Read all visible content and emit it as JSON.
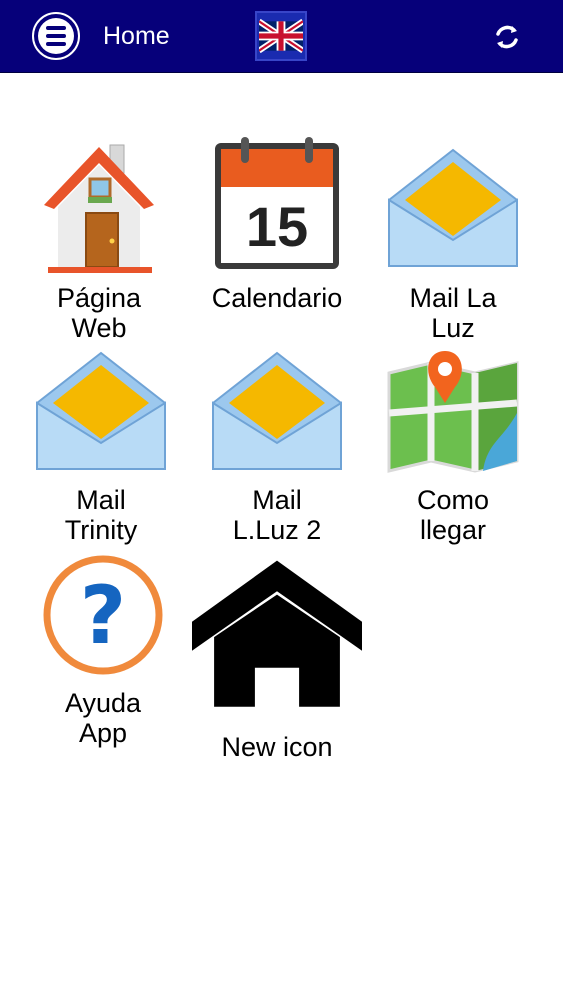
{
  "header": {
    "title": "Home",
    "menu_icon": "menu-icon",
    "flag_icon": "uk-flag-icon",
    "refresh_icon": "refresh-icon",
    "bar_color": "#06007a"
  },
  "grid": {
    "items": [
      {
        "label": "Página\nWeb",
        "icon": "house-icon"
      },
      {
        "label": "Calendario",
        "icon": "calendar-icon",
        "calendar_day": "15"
      },
      {
        "label": "Mail La\nLuz",
        "icon": "envelope-icon"
      },
      {
        "label": "Mail\nTrinity",
        "icon": "envelope-icon"
      },
      {
        "label": "Mail\nL.Luz 2",
        "icon": "envelope-icon"
      },
      {
        "label": "Como\nllegar",
        "icon": "map-icon"
      },
      {
        "label": "Ayuda\nApp",
        "icon": "help-icon"
      },
      {
        "label": "New icon",
        "icon": "black-house-icon"
      }
    ]
  }
}
